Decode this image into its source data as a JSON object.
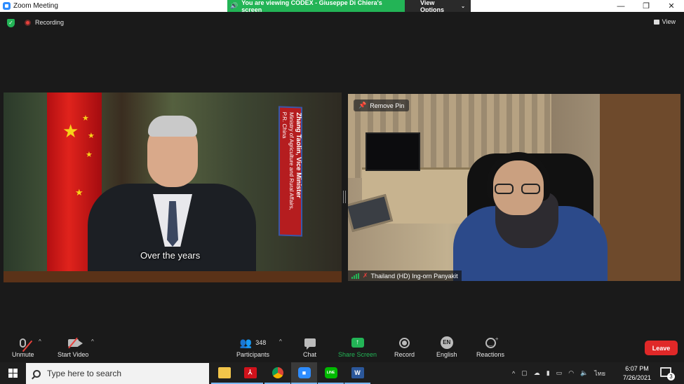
{
  "window": {
    "title": "Zoom Meeting",
    "minimize_glyph": "—",
    "restore_glyph": "❐",
    "close_glyph": "✕"
  },
  "share_banner": {
    "text": "You are viewing CODEX - Giuseppe Di Chiera's screen",
    "view_options": "View Options",
    "color": "#23b456"
  },
  "status": {
    "recording_label": "Recording",
    "view_label": "View"
  },
  "video_left": {
    "nameplate_name": "Zhang Taolin, Vice Minister",
    "nameplate_line2": "Ministry of Agriculture and Rural Affairs,",
    "nameplate_line3": "P.R. China",
    "caption": "Over the years"
  },
  "video_right": {
    "remove_pin_label": "Remove Pin",
    "participant_name": "Thailand (HD) Ing-orn Panyakit"
  },
  "toolbar": {
    "unmute": "Unmute",
    "start_video": "Start Video",
    "participants": "Participants",
    "participants_count": "348",
    "chat": "Chat",
    "share_screen": "Share Screen",
    "record": "Record",
    "language": "English",
    "language_code": "EN",
    "reactions": "Reactions",
    "leave": "Leave",
    "leave_color": "#e02828"
  },
  "taskbar": {
    "search_placeholder": "Type here to search",
    "apps": [
      "file-explorer-icon",
      "acrobat-icon",
      "chrome-icon",
      "zoom-icon",
      "line-icon",
      "word-icon"
    ],
    "line_label": "LINE",
    "word_label": "W",
    "time": "6:07 PM",
    "date": "7/26/2021",
    "notification_count": "3",
    "input_lang": "ไทย"
  }
}
